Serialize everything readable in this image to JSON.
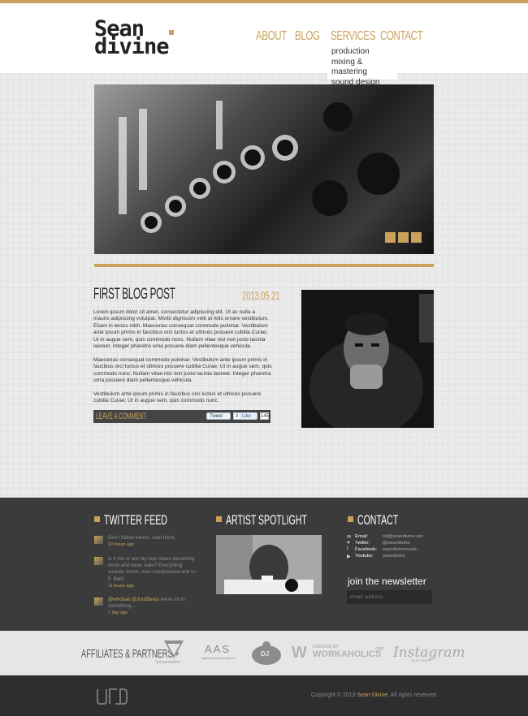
{
  "brand": {
    "logo_line1": "Sean",
    "logo_line2": "divine",
    "accent": "#c9a15c"
  },
  "nav": {
    "about": "ABOUT",
    "blog": "BLOG",
    "services": "SERVICES",
    "contact": "CONTACT"
  },
  "submenu": [
    "production",
    "mixing & mastering",
    "sound design"
  ],
  "slider": {
    "slide_count": 3
  },
  "post": {
    "title": "FIRST BLOG POST",
    "date": "2013.05.21",
    "paragraphs": [
      "Lorem ipsum dolor sit amet, consectetur adipiscing elit. Ut ac nulla a mauris adipiscing volutpat. Morbi dignissim velit at felis ornare vestibulum. Etiam in lectus nibh. Maecenas consequat commodo pulvinar. Vestibulum ante ipsum primis in faucibus orci luctus et ultrices posuere cubilia Curae; Ut in augue sem, quis commodo nunc. Nullam vitae nisi non justo lacinia laoreet. Integer pharetra urna posuere diam pellentesque vehicula.",
      "Maecenas consequat commodo pulvinar. Vestibulum ante ipsum primis in faucibus orci luctus et ultrices posuere cubilia Curae; Ut in augue sem, quis commodo nunc. Nullam vitae nisi non justo lacinia laoreet. Integer pharetra urna posuere diam pellentesque vehicula.",
      "Vestibulum ante ipsum primis in faucibus orci luctus et ultrices posuere cubilia Curae; Ut in augue sem, quis commodo nunc."
    ],
    "comment_label": "LEAVE A COMMENT",
    "tweet_label": "Tweet",
    "tweet_count": "3",
    "like_label": "Like",
    "like_count": "145"
  },
  "footer": {
    "twitter_title": "TWITTER FEED",
    "tweets": [
      {
        "text": "Don't follow trends, start them.",
        "time": "10 hours ago"
      },
      {
        "text": "Is it me or are hip hop mixes becoming more and more stale? Everything sounds mono, over-compressed and lo-fi. Blah.",
        "time": "11 hours ago"
      },
      {
        "mentions": "@wholsat @JurdBeats",
        "text": " we're on to something...",
        "time": "1 day ago"
      }
    ],
    "spotlight_title": "ARTIST SPOTLIGHT",
    "contact_title": "CONTACT",
    "contacts": [
      {
        "icon": "mail-icon",
        "glyph": "✉",
        "label": "Email:",
        "value": "sd@seandivine.net"
      },
      {
        "icon": "twitter-icon",
        "glyph": "♥",
        "label": "Twitter:",
        "value": "@seandivine"
      },
      {
        "icon": "facebook-icon",
        "glyph": "f",
        "label": "Facebook:",
        "value": "seandivinemusic"
      },
      {
        "icon": "youtube-icon",
        "glyph": "▶",
        "label": "Youtube:",
        "value": "seandivine"
      }
    ],
    "newsletter_title": "join the newsletter",
    "email_placeholder": "email address"
  },
  "affiliates": {
    "label": "AFFILIATES & PARTNERS +",
    "logos": {
      "lyricanmotion": "lyricanmotion",
      "aas": "AAS",
      "aas_sub": "Applied Acoustics Systems",
      "dj_logo": "DJ",
      "workaholics_top": "CREATED BY",
      "workaholics": "WORKAHOLICS",
      "workaholics_sup": "DSR",
      "instagram": "Instagram",
      "instagram_sub": "Sean Divine"
    }
  },
  "copyright": {
    "prefix": "Copyright © 2013 ",
    "name": "Sean Divine",
    "suffix": ". All rights reserved."
  }
}
